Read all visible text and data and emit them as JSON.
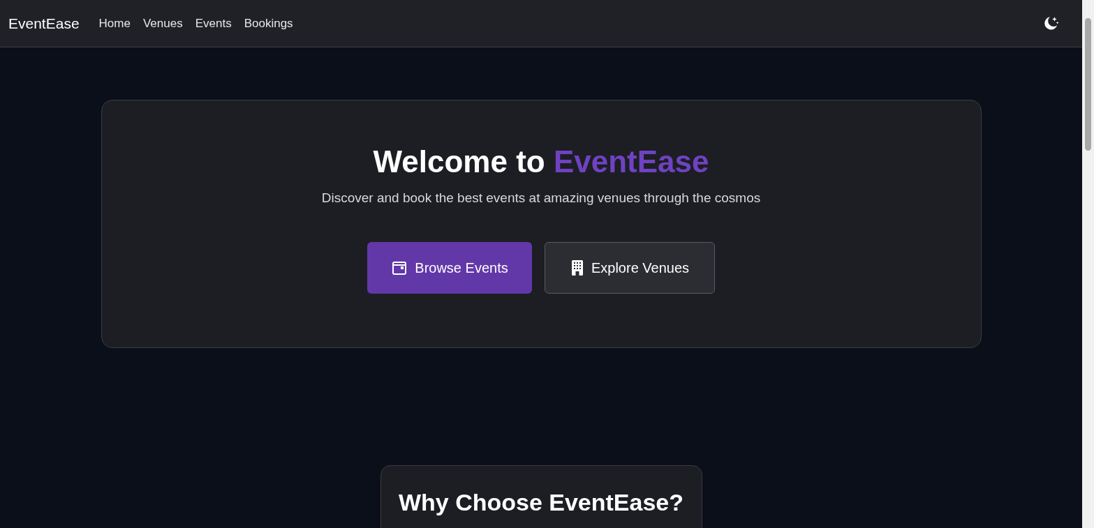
{
  "navbar": {
    "brand": "EventEase",
    "links": [
      {
        "label": "Home"
      },
      {
        "label": "Venues"
      },
      {
        "label": "Events"
      },
      {
        "label": "Bookings"
      }
    ]
  },
  "hero": {
    "title_lead": "Welcome to",
    "title_brand": "EventEase",
    "subtitle": "Discover and book the best events at amazing venues through the cosmos",
    "buttons": [
      {
        "label": "Browse Events",
        "kind": "primary"
      },
      {
        "label": "Explore Venues",
        "kind": "secondary"
      }
    ]
  },
  "features": {
    "title": "Why Choose EventEase?"
  }
}
